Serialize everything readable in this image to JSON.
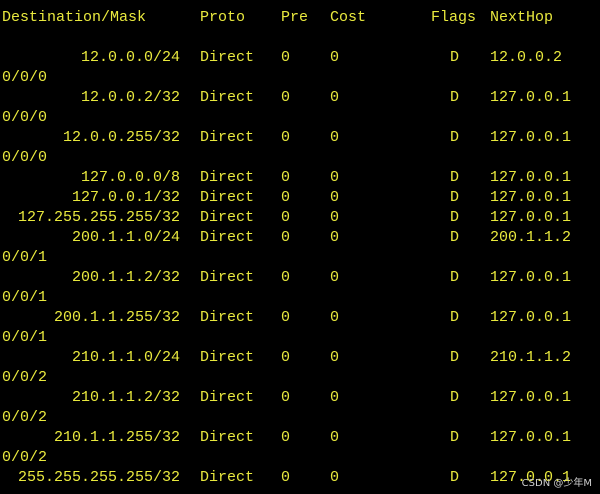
{
  "terminal": {
    "bg_color": "#000000",
    "text_color": "#e9e93e",
    "header": {
      "destination": "Destination/Mask",
      "proto": "Proto",
      "pre": "Pre",
      "cost": "Cost",
      "flags": "Flags",
      "nexthop": "NextHop"
    },
    "routes": [
      {
        "dest": "12.0.0.0/24",
        "proto": "Direct",
        "pre": "0",
        "cost": "0",
        "flags": "D",
        "nexthop": "12.0.0.2",
        "iface": "0/0/0"
      },
      {
        "dest": "12.0.0.2/32",
        "proto": "Direct",
        "pre": "0",
        "cost": "0",
        "flags": "D",
        "nexthop": "127.0.0.1",
        "iface": "0/0/0"
      },
      {
        "dest": "12.0.0.255/32",
        "proto": "Direct",
        "pre": "0",
        "cost": "0",
        "flags": "D",
        "nexthop": "127.0.0.1",
        "iface": "0/0/0"
      },
      {
        "dest": "127.0.0.0/8",
        "proto": "Direct",
        "pre": "0",
        "cost": "0",
        "flags": "D",
        "nexthop": "127.0.0.1",
        "iface": ""
      },
      {
        "dest": "127.0.0.1/32",
        "proto": "Direct",
        "pre": "0",
        "cost": "0",
        "flags": "D",
        "nexthop": "127.0.0.1",
        "iface": ""
      },
      {
        "dest": "127.255.255.255/32",
        "proto": "Direct",
        "pre": "0",
        "cost": "0",
        "flags": "D",
        "nexthop": "127.0.0.1",
        "iface": ""
      },
      {
        "dest": "200.1.1.0/24",
        "proto": "Direct",
        "pre": "0",
        "cost": "0",
        "flags": "D",
        "nexthop": "200.1.1.2",
        "iface": "0/0/1"
      },
      {
        "dest": "200.1.1.2/32",
        "proto": "Direct",
        "pre": "0",
        "cost": "0",
        "flags": "D",
        "nexthop": "127.0.0.1",
        "iface": "0/0/1"
      },
      {
        "dest": "200.1.1.255/32",
        "proto": "Direct",
        "pre": "0",
        "cost": "0",
        "flags": "D",
        "nexthop": "127.0.0.1",
        "iface": "0/0/1"
      },
      {
        "dest": "210.1.1.0/24",
        "proto": "Direct",
        "pre": "0",
        "cost": "0",
        "flags": "D",
        "nexthop": "210.1.1.2",
        "iface": "0/0/2"
      },
      {
        "dest": "210.1.1.2/32",
        "proto": "Direct",
        "pre": "0",
        "cost": "0",
        "flags": "D",
        "nexthop": "127.0.0.1",
        "iface": "0/0/2"
      },
      {
        "dest": "210.1.1.255/32",
        "proto": "Direct",
        "pre": "0",
        "cost": "0",
        "flags": "D",
        "nexthop": "127.0.0.1",
        "iface": "0/0/2"
      },
      {
        "dest": "255.255.255.255/32",
        "proto": "Direct",
        "pre": "0",
        "cost": "0",
        "flags": "D",
        "nexthop": "127.0.0.1",
        "iface": ""
      }
    ],
    "watermark": "CSDN @少年M"
  }
}
